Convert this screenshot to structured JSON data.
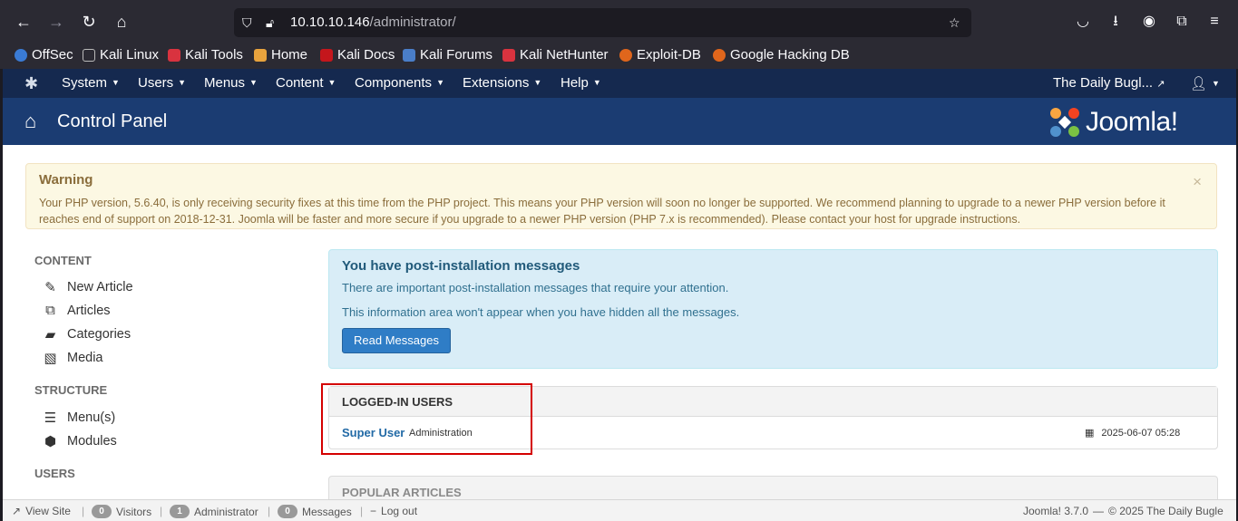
{
  "browser": {
    "url_host": "10.10.10.146",
    "url_path": "/administrator/",
    "bookmarks": [
      "OffSec",
      "Kali Linux",
      "Kali Tools",
      "Home",
      "Kali Docs",
      "Kali Forums",
      "Kali NetHunter",
      "Exploit-DB",
      "Google Hacking DB"
    ]
  },
  "topnav": {
    "menu": [
      "System",
      "Users",
      "Menus",
      "Content",
      "Components",
      "Extensions",
      "Help"
    ],
    "site_link": "The Daily Bugl...",
    "user_icon": "user-icon"
  },
  "header": {
    "title": "Control Panel",
    "brand": "Joomla!"
  },
  "warning": {
    "title": "Warning",
    "text": "Your PHP version, 5.6.40, is only receiving security fixes at this time from the PHP project. This means your PHP version will soon no longer be supported. We recommend planning to upgrade to a newer PHP version before it reaches end of support on 2018-12-31. Joomla will be faster and more secure if you upgrade to a newer PHP version (PHP 7.x is recommended). Please contact your host for upgrade instructions.",
    "close": "×"
  },
  "sidebar": {
    "content_heading": "CONTENT",
    "content_items": [
      "New Article",
      "Articles",
      "Categories",
      "Media"
    ],
    "structure_heading": "STRUCTURE",
    "structure_items": [
      "Menu(s)",
      "Modules"
    ],
    "users_heading": "USERS"
  },
  "postinstall": {
    "title": "You have post-installation messages",
    "line1": "There are important post-installation messages that require your attention.",
    "line2": "This information area won't appear when you have hidden all the messages.",
    "button": "Read Messages"
  },
  "logged_in": {
    "title": "LOGGED-IN USERS",
    "user": "Super User",
    "role": "Administration",
    "date": "2025-06-07 05:28"
  },
  "popular": {
    "title": "POPULAR ARTICLES"
  },
  "statusbar": {
    "view_site": "View Site",
    "visitors_count": "0",
    "visitors_label": "Visitors",
    "admin_count": "1",
    "admin_label": "Administrator",
    "messages_count": "0",
    "messages_label": "Messages",
    "logout": "Log out",
    "version": "Joomla! 3.7.0",
    "copyright": "© 2025 The Daily Bugle",
    "dash": "—"
  },
  "colors": {
    "nav_bg": "#15294f",
    "header_bg": "#1b3c72",
    "highlight": "#d40000",
    "button_blue": "#2f7dc6"
  }
}
